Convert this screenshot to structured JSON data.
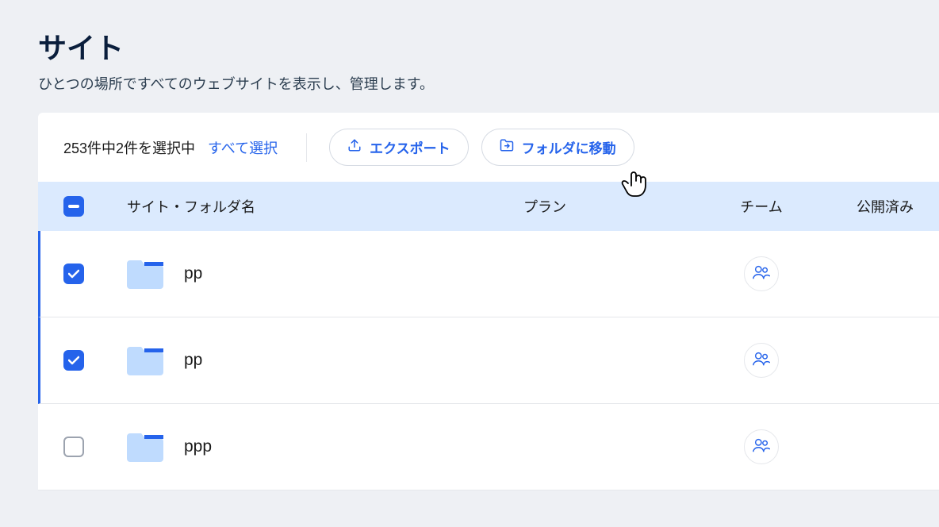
{
  "header": {
    "title": "サイト",
    "subtitle": "ひとつの場所ですべてのウェブサイトを表示し、管理します。"
  },
  "toolbar": {
    "selection_text": "253件中2件を選択中",
    "select_all_label": "すべて選択",
    "export_label": "エクスポート",
    "move_folder_label": "フォルダに移動"
  },
  "table": {
    "columns": {
      "name": "サイト・フォルダ名",
      "plan": "プラン",
      "team": "チーム",
      "published": "公開済み"
    },
    "rows": [
      {
        "name": "pp",
        "selected": true
      },
      {
        "name": "pp",
        "selected": true
      },
      {
        "name": "ppp",
        "selected": false
      }
    ]
  }
}
